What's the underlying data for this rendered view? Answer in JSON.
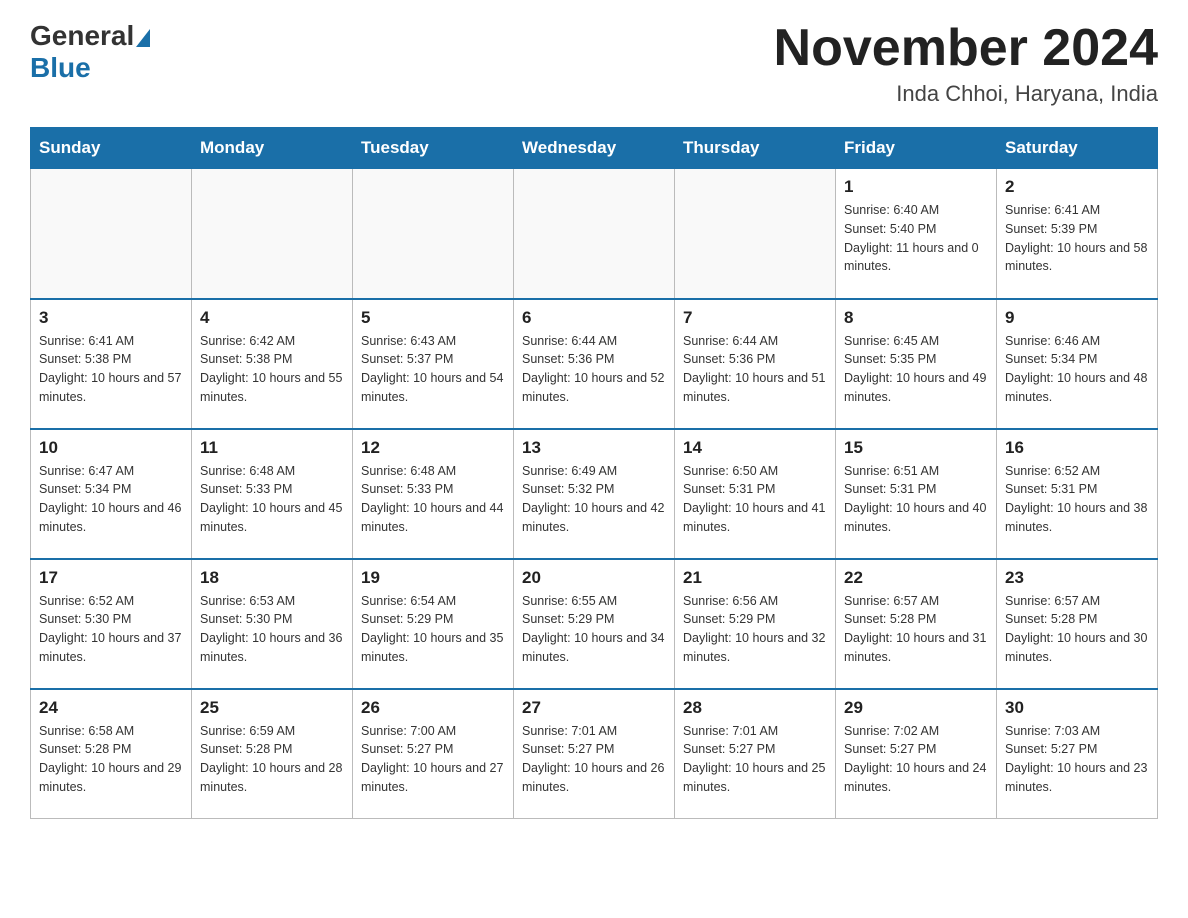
{
  "header": {
    "logo_general": "General",
    "logo_blue": "Blue",
    "month_title": "November 2024",
    "location": "Inda Chhoi, Haryana, India"
  },
  "days_of_week": [
    "Sunday",
    "Monday",
    "Tuesday",
    "Wednesday",
    "Thursday",
    "Friday",
    "Saturday"
  ],
  "weeks": [
    [
      {
        "day": "",
        "info": ""
      },
      {
        "day": "",
        "info": ""
      },
      {
        "day": "",
        "info": ""
      },
      {
        "day": "",
        "info": ""
      },
      {
        "day": "",
        "info": ""
      },
      {
        "day": "1",
        "info": "Sunrise: 6:40 AM\nSunset: 5:40 PM\nDaylight: 11 hours and 0 minutes."
      },
      {
        "day": "2",
        "info": "Sunrise: 6:41 AM\nSunset: 5:39 PM\nDaylight: 10 hours and 58 minutes."
      }
    ],
    [
      {
        "day": "3",
        "info": "Sunrise: 6:41 AM\nSunset: 5:38 PM\nDaylight: 10 hours and 57 minutes."
      },
      {
        "day": "4",
        "info": "Sunrise: 6:42 AM\nSunset: 5:38 PM\nDaylight: 10 hours and 55 minutes."
      },
      {
        "day": "5",
        "info": "Sunrise: 6:43 AM\nSunset: 5:37 PM\nDaylight: 10 hours and 54 minutes."
      },
      {
        "day": "6",
        "info": "Sunrise: 6:44 AM\nSunset: 5:36 PM\nDaylight: 10 hours and 52 minutes."
      },
      {
        "day": "7",
        "info": "Sunrise: 6:44 AM\nSunset: 5:36 PM\nDaylight: 10 hours and 51 minutes."
      },
      {
        "day": "8",
        "info": "Sunrise: 6:45 AM\nSunset: 5:35 PM\nDaylight: 10 hours and 49 minutes."
      },
      {
        "day": "9",
        "info": "Sunrise: 6:46 AM\nSunset: 5:34 PM\nDaylight: 10 hours and 48 minutes."
      }
    ],
    [
      {
        "day": "10",
        "info": "Sunrise: 6:47 AM\nSunset: 5:34 PM\nDaylight: 10 hours and 46 minutes."
      },
      {
        "day": "11",
        "info": "Sunrise: 6:48 AM\nSunset: 5:33 PM\nDaylight: 10 hours and 45 minutes."
      },
      {
        "day": "12",
        "info": "Sunrise: 6:48 AM\nSunset: 5:33 PM\nDaylight: 10 hours and 44 minutes."
      },
      {
        "day": "13",
        "info": "Sunrise: 6:49 AM\nSunset: 5:32 PM\nDaylight: 10 hours and 42 minutes."
      },
      {
        "day": "14",
        "info": "Sunrise: 6:50 AM\nSunset: 5:31 PM\nDaylight: 10 hours and 41 minutes."
      },
      {
        "day": "15",
        "info": "Sunrise: 6:51 AM\nSunset: 5:31 PM\nDaylight: 10 hours and 40 minutes."
      },
      {
        "day": "16",
        "info": "Sunrise: 6:52 AM\nSunset: 5:31 PM\nDaylight: 10 hours and 38 minutes."
      }
    ],
    [
      {
        "day": "17",
        "info": "Sunrise: 6:52 AM\nSunset: 5:30 PM\nDaylight: 10 hours and 37 minutes."
      },
      {
        "day": "18",
        "info": "Sunrise: 6:53 AM\nSunset: 5:30 PM\nDaylight: 10 hours and 36 minutes."
      },
      {
        "day": "19",
        "info": "Sunrise: 6:54 AM\nSunset: 5:29 PM\nDaylight: 10 hours and 35 minutes."
      },
      {
        "day": "20",
        "info": "Sunrise: 6:55 AM\nSunset: 5:29 PM\nDaylight: 10 hours and 34 minutes."
      },
      {
        "day": "21",
        "info": "Sunrise: 6:56 AM\nSunset: 5:29 PM\nDaylight: 10 hours and 32 minutes."
      },
      {
        "day": "22",
        "info": "Sunrise: 6:57 AM\nSunset: 5:28 PM\nDaylight: 10 hours and 31 minutes."
      },
      {
        "day": "23",
        "info": "Sunrise: 6:57 AM\nSunset: 5:28 PM\nDaylight: 10 hours and 30 minutes."
      }
    ],
    [
      {
        "day": "24",
        "info": "Sunrise: 6:58 AM\nSunset: 5:28 PM\nDaylight: 10 hours and 29 minutes."
      },
      {
        "day": "25",
        "info": "Sunrise: 6:59 AM\nSunset: 5:28 PM\nDaylight: 10 hours and 28 minutes."
      },
      {
        "day": "26",
        "info": "Sunrise: 7:00 AM\nSunset: 5:27 PM\nDaylight: 10 hours and 27 minutes."
      },
      {
        "day": "27",
        "info": "Sunrise: 7:01 AM\nSunset: 5:27 PM\nDaylight: 10 hours and 26 minutes."
      },
      {
        "day": "28",
        "info": "Sunrise: 7:01 AM\nSunset: 5:27 PM\nDaylight: 10 hours and 25 minutes."
      },
      {
        "day": "29",
        "info": "Sunrise: 7:02 AM\nSunset: 5:27 PM\nDaylight: 10 hours and 24 minutes."
      },
      {
        "day": "30",
        "info": "Sunrise: 7:03 AM\nSunset: 5:27 PM\nDaylight: 10 hours and 23 minutes."
      }
    ]
  ]
}
